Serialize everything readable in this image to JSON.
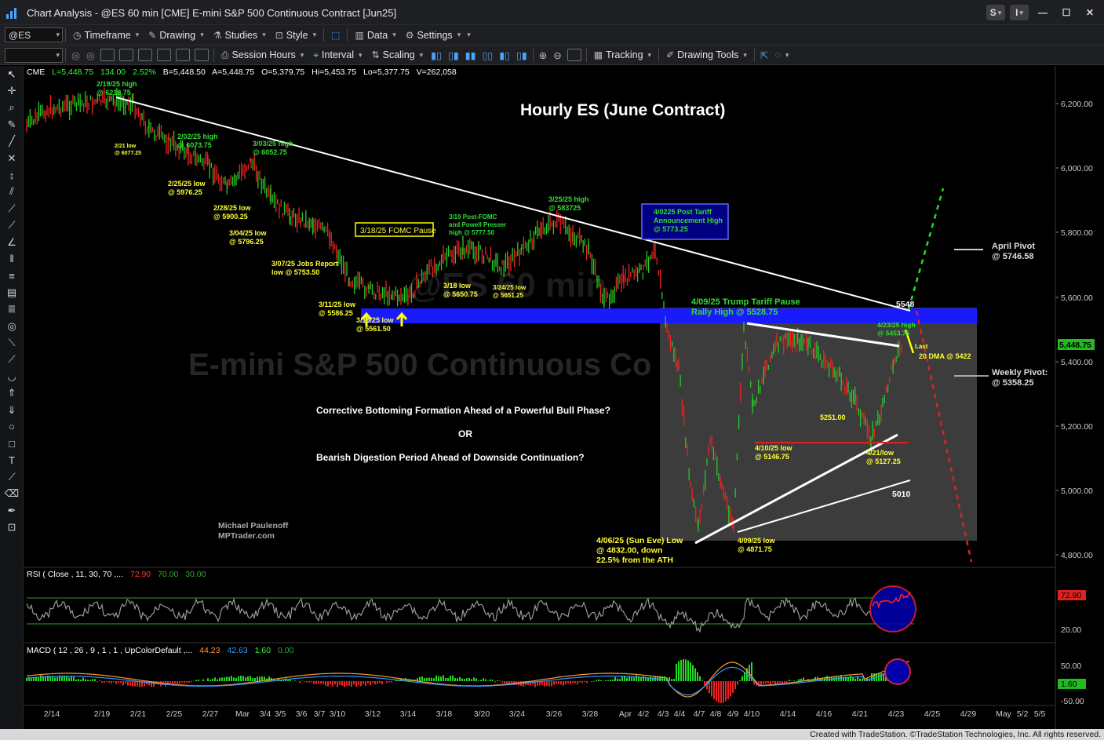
{
  "window": {
    "title": "Chart Analysis - @ES 60 min [CME] E-mini S&P 500 Continuous Contract [Jun25]",
    "buttons": [
      "S",
      "I"
    ]
  },
  "toolbar1": {
    "symbol": "@ES",
    "items": [
      "Timeframe",
      "Drawing",
      "Studies",
      "Style",
      "Data",
      "Settings"
    ]
  },
  "toolbar2": {
    "items": [
      "Session Hours",
      "Interval",
      "Scaling",
      "Tracking",
      "Drawing Tools"
    ]
  },
  "header": {
    "exchange": "CME",
    "last": "L=5,448.75",
    "change": "134.00",
    "pct": "2.52%",
    "bid": "B=5,448.50",
    "ask": "A=5,448.75",
    "open": "O=5,379.75",
    "high": "Hi=5,453.75",
    "low": "Lo=5,377.75",
    "volume": "V=262,058"
  },
  "chart": {
    "title": "Hourly ES (June Contract)",
    "watermark": "E-mini S&P 500 Continuous Co",
    "watermark2": "@ES 60 min",
    "question": [
      "Corrective Bottoming Formation Ahead of a Powerful Bull Phase?",
      "OR",
      "Bearish Digestion Period Ahead of Downside Continuation?"
    ],
    "author": [
      "Michael Paulenoff",
      "MPTrader.com"
    ],
    "last_price_tag": "5,448.75",
    "price_ticks": [
      "6,200.00",
      "6,000.00",
      "5,800.00",
      "5,600.00",
      "5,400.00",
      "5,200.00",
      "5,000.00",
      "4,800.00"
    ],
    "date_ticks": [
      "2/14",
      "2/19",
      "2/21",
      "2/25",
      "2/27",
      "Mar",
      "3/4",
      "3/5",
      "3/6",
      "3/7",
      "3/10",
      "3/12",
      "3/14",
      "3/18",
      "3/20",
      "3/24",
      "3/26",
      "3/28",
      "Apr",
      "4/2",
      "4/3",
      "4/4",
      "4/7",
      "4/8",
      "4/9",
      "4/10",
      "4/14",
      "4/16",
      "4/21",
      "4/23",
      "4/25",
      "4/29",
      "May",
      "5/2",
      "5/5"
    ],
    "annotations": [
      {
        "lines": [
          "2/19/25 high",
          "@ 6218.75"
        ],
        "color": "#33dd33"
      },
      {
        "lines": [
          "2/21 low",
          "@ 6077.25"
        ],
        "color": "#ffff33"
      },
      {
        "lines": [
          "2/02/25 high",
          "@ 6073.75"
        ],
        "color": "#33dd33"
      },
      {
        "lines": [
          "3/03/25 high",
          "@ 6052.75"
        ],
        "color": "#33dd33"
      },
      {
        "lines": [
          "2/25/25 low",
          "@ 5976.25"
        ],
        "color": "#ffff33"
      },
      {
        "lines": [
          "2/28/25 low",
          "@ 5900.25"
        ],
        "color": "#ffff33"
      },
      {
        "lines": [
          "3/04/25 low",
          "@ 5796.25"
        ],
        "color": "#ffff33"
      },
      {
        "lines": [
          "3/07/25 Jobs Report",
          "low @ 5753.50"
        ],
        "color": "#ffff33"
      },
      {
        "lines": [
          "3/11/25 low",
          "@ 5586.25"
        ],
        "color": "#ffff33"
      },
      {
        "lines": [
          "3/13/25 low",
          "@ 5561.50"
        ],
        "color": "#ffff33"
      },
      {
        "lines": [
          "3/19 Post-FOMC",
          "and Powell Presser",
          "high @ 5777.50"
        ],
        "color": "#33dd33"
      },
      {
        "lines": [
          "3/18 low",
          "@ 5650.75"
        ],
        "color": "#ffff33"
      },
      {
        "lines": [
          "3/24/25 low",
          "@ 5651.25"
        ],
        "color": "#ffff33"
      },
      {
        "lines": [
          "3/25/25 high",
          "@ 583725"
        ],
        "color": "#33dd33"
      },
      {
        "lines": [
          "4/0225 Post Tariff",
          "Announcement High",
          "@ 5773.25"
        ],
        "color": "#33dd33"
      },
      {
        "lines": [
          "4/09/25 Trump Tariff Pause",
          "Rally High @ 5528.75"
        ],
        "color": "#33dd33"
      },
      {
        "lines": [
          "4/23/25 high",
          "@ 5453.75"
        ],
        "color": "#33dd33"
      },
      {
        "lines": [
          "Last"
        ],
        "color": "#ffff33"
      },
      {
        "lines": [
          "20 DMA @ 5422"
        ],
        "color": "#ffff33"
      },
      {
        "lines": [
          "5251.00"
        ],
        "color": "#ffff33"
      },
      {
        "lines": [
          "4/10/25 low",
          "@ 5146.75"
        ],
        "color": "#ffff33"
      },
      {
        "lines": [
          "4/21/low",
          "@ 5127.25"
        ],
        "color": "#ffff33"
      },
      {
        "lines": [
          "5010"
        ],
        "color": "#ffffff"
      },
      {
        "lines": [
          "5548"
        ],
        "color": "#ffffff"
      },
      {
        "lines": [
          "4/06/25 (Sun Eve) Low",
          "@ 4832.00, down",
          "22.5% from the ATH"
        ],
        "color": "#ffff33"
      },
      {
        "lines": [
          "4/09/25 low",
          "@ 4871.75"
        ],
        "color": "#ffff33"
      },
      {
        "lines": [
          "April Pivot",
          "@ 5746.58"
        ],
        "color": "#dddddd"
      },
      {
        "lines": [
          "Weekly Pivot:",
          "@ 5358.25"
        ],
        "color": "#dddddd"
      }
    ],
    "fomc_box": "3/18/25 FOMC Pause"
  },
  "rsi": {
    "label": "RSI ( Close , 11, 30, 70 ,...",
    "values": [
      "72.90",
      "70.00",
      "30.00"
    ],
    "ticks": [
      "72.90",
      "20.00"
    ]
  },
  "macd": {
    "label": "MACD ( 12 , 26 , 9 , 1 , 1 , UpColorDefault ,...",
    "values": [
      "44.23",
      "42.63",
      "1.60",
      "0.00"
    ],
    "ticks": [
      "50.00",
      "1.60",
      "-50.00"
    ]
  },
  "status": {
    "text": "Created with TradeStation. ©TradeStation Technologies, Inc. All rights reserved."
  },
  "colors": {
    "up": "#22cc22",
    "down": "#ee2222",
    "zone": "#1a1aff",
    "bg": "#000000"
  }
}
